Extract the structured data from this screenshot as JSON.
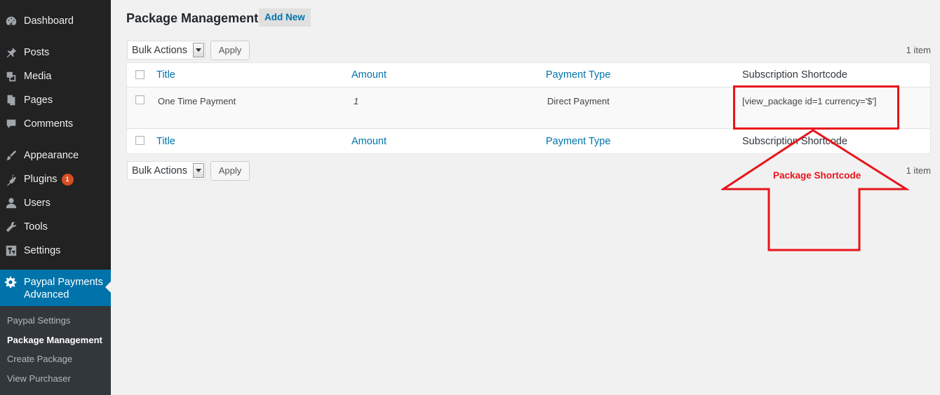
{
  "sidebar": {
    "items": [
      {
        "label": "Dashboard",
        "icon": "dashboard-icon"
      },
      {
        "label": "Posts",
        "icon": "pin-icon"
      },
      {
        "label": "Media",
        "icon": "media-icon"
      },
      {
        "label": "Pages",
        "icon": "pages-icon"
      },
      {
        "label": "Comments",
        "icon": "comment-icon"
      },
      {
        "label": "Appearance",
        "icon": "paintbrush-icon"
      },
      {
        "label": "Plugins",
        "icon": "plugin-icon",
        "badge": "1"
      },
      {
        "label": "Users",
        "icon": "user-icon"
      },
      {
        "label": "Tools",
        "icon": "wrench-icon"
      },
      {
        "label": "Settings",
        "icon": "settings-icon"
      }
    ],
    "active": {
      "label": "Paypal Payments Advanced",
      "icon": "gear-icon"
    },
    "submenu": [
      "Paypal Settings",
      "Package Management",
      "Create Package",
      "View Purchaser"
    ],
    "submenu_current": "Package Management"
  },
  "header": {
    "title": "Package Management",
    "add_new_label": "Add New"
  },
  "toolbar_top": {
    "bulk_label": "Bulk Actions",
    "apply_label": "Apply",
    "count": "1 item"
  },
  "toolbar_bottom": {
    "bulk_label": "Bulk Actions",
    "apply_label": "Apply",
    "count": "1 item"
  },
  "table": {
    "columns": [
      "Title",
      "Amount",
      "Payment Type",
      "Subscription Shortcode"
    ],
    "rows": [
      {
        "title": "One Time Payment",
        "amount": "1",
        "payment_type": "Direct Payment",
        "shortcode": "[view_package id=1 currency='$']"
      }
    ]
  },
  "annotation": {
    "label": "Package Shortcode",
    "color": "#e8141b"
  },
  "colors": {
    "sidebar": "#222222",
    "active": "#0073aa",
    "link": "#0073aa",
    "badge": "#d54e21"
  }
}
